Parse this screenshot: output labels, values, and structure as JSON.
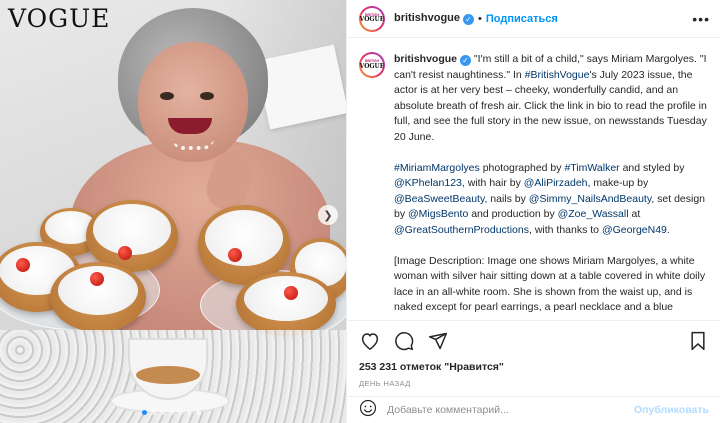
{
  "photo": {
    "brand": "VOGUE",
    "alt_subject": "Miriam Margolyes with iced buns"
  },
  "header": {
    "avatar_line1": "BRITISH",
    "avatar_line2": "VOGUE",
    "username": "britishvogue",
    "separator": "•",
    "follow_label": "Подписаться",
    "more_label": "•••"
  },
  "caption": {
    "username": "britishvogue",
    "p1_a": " \"I'm still a bit of a child,\" says Miriam Margolyes. \"I can't resist naughtiness.\" In ",
    "p1_tag": "#BritishVogue",
    "p1_b": "'s July 2023 issue, the actor is at her very best – cheeky, wonderfully candid, and an absolute breath of fresh air. Click the link in bio to read the profile in full, and see the full story in the new issue, on newsstands Tuesday 20 June.",
    "p2_tag1": "#MiriamMargolyes",
    "p2_t1": " photographed by ",
    "p2_tag2": "#TimWalker",
    "p2_t2": " and styled by ",
    "p2_tag3": "@KPhelan123",
    "p2_t3": ", with hair by ",
    "p2_tag4": "@AliPirzadeh",
    "p2_t4": ", make-up by ",
    "p2_tag5": "@BeaSweetBeauty",
    "p2_t5": ", nails by ",
    "p2_tag6": "@Simmy_NailsAndBeauty",
    "p2_t6": ", set design by ",
    "p2_tag7": "@MigsBento",
    "p2_t7": " and production by ",
    "p2_tag8": "@Zoe_Wassall",
    "p2_t8": " at ",
    "p2_tag9": "@GreatSouthernProductions",
    "p2_t9": ", with thanks to ",
    "p2_tag10": "@GeorgeN49",
    "p2_t10": ".",
    "p3": "[Image Description: Image one shows Miriam Margolyes, a white woman with silver hair sitting down at a table covered in white doily lace in an all-white room. She is shown from the waist up, and is naked except for pearl earrings, a pearl necklace and a blue cocktail ring. She is also wearing red nail varnish, a dark pink lipstick and has a small beauty spot drawn under the outer edge"
  },
  "actions": {
    "like_icon": "heart-icon",
    "comment_icon": "comment-icon",
    "share_icon": "share-icon",
    "save_icon": "bookmark-icon",
    "likes_text": "253 231 отметок \"Нравится\"",
    "time_text": "ДЕНЬ НАЗАД"
  },
  "add_comment": {
    "emoji_icon": "emoji-icon",
    "placeholder": "Добавьте комментарий...",
    "publish_label": "Опубликовать"
  },
  "colors": {
    "link": "#00376b",
    "follow": "#0095f6",
    "verified": "#3897f0",
    "publish_disabled": "#b3dbff"
  }
}
